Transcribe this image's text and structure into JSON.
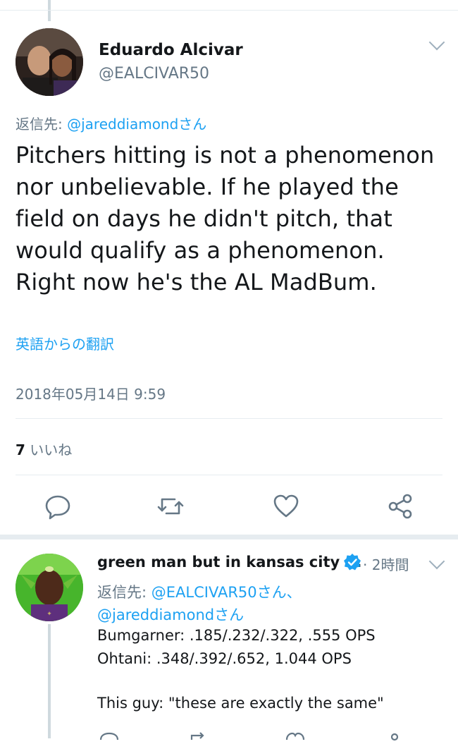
{
  "main_tweet": {
    "author_name": "Eduardo Alcivar",
    "author_handle": "@EALCIVAR50",
    "reply_prefix": "返信先: ",
    "reply_to": "@jareddiamondさん",
    "body_lines": [
      "Pitchers hitting is not a phenomenon",
      "nor unbelievable.  If he played the",
      "field on days he didn't pitch, that",
      "would qualify as a phenomenon.",
      "Right now he's the AL MadBum."
    ],
    "translate_link": "英語からの翻訳",
    "timestamp": "2018年05月14日 9:59",
    "likes_count": "7",
    "likes_label": " いいね"
  },
  "reply_tweet": {
    "author_name": "green man but in kansas city ...",
    "time": "· 2時間",
    "reply_prefix": "返信先: ",
    "reply_to_1": "@EALCIVAR50さん、",
    "reply_to_2": "@jareddiamondさん",
    "body_lines": [
      "Bumgarner: .185/.232/.322, .555 OPS",
      "Ohtani: .348/.392/.652, 1.044 OPS",
      "",
      "This guy: \"these are exactly the same\""
    ]
  },
  "icons": [
    "reply-icon",
    "retweet-icon",
    "like-icon",
    "share-icon",
    "verified-icon",
    "chevron-down-icon"
  ],
  "colors": {
    "link": "#1da1f2",
    "secondary_text": "#657786",
    "divider": "#e6ecf0"
  }
}
